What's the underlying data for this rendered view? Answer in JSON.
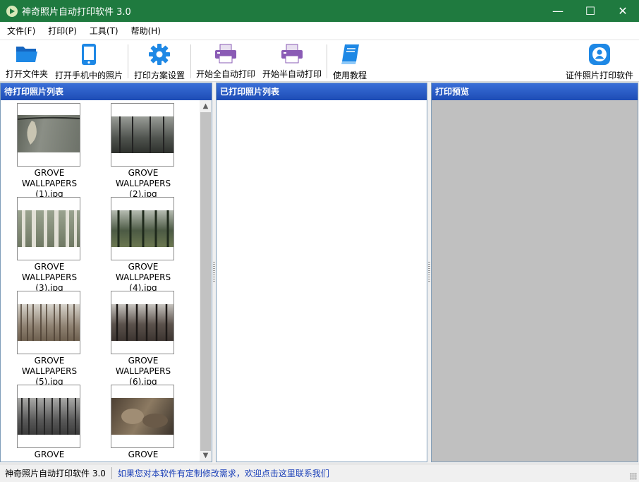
{
  "window": {
    "title": "神奇照片自动打印软件 3.0",
    "controls": {
      "minimize": "—",
      "maximize": "☐",
      "close": "✕"
    }
  },
  "menu": [
    {
      "label": "文件(F)"
    },
    {
      "label": "打印(P)"
    },
    {
      "label": "工具(T)"
    },
    {
      "label": "帮助(H)"
    }
  ],
  "toolbar": {
    "open_folder": "打开文件夹",
    "open_phone_photos": "打开手机中的照片",
    "print_settings": "打印方案设置",
    "auto_print": "开始全自动打印",
    "semi_auto_print": "开始半自动打印",
    "tutorial": "使用教程",
    "id_photo_software": "证件照片打印软件"
  },
  "panels": {
    "pending": {
      "title": "待打印照片列表",
      "items": [
        {
          "caption_line1": "GROVE WALLPAPERS",
          "caption_line2": "(1).jpg"
        },
        {
          "caption_line1": "GROVE WALLPAPERS",
          "caption_line2": "(2).jpg"
        },
        {
          "caption_line1": "GROVE WALLPAPERS",
          "caption_line2": "(3).jpg"
        },
        {
          "caption_line1": "GROVE WALLPAPERS",
          "caption_line2": "(4).jpg"
        },
        {
          "caption_line1": "GROVE WALLPAPERS",
          "caption_line2": "(5).jpg"
        },
        {
          "caption_line1": "GROVE WALLPAPERS",
          "caption_line2": "(6).jpg"
        },
        {
          "caption_line1": "GROVE WALLPAPERS",
          "caption_line2": ""
        },
        {
          "caption_line1": "GROVE WALLPAPERS",
          "caption_line2": ""
        }
      ]
    },
    "printed": {
      "title": "已打印照片列表"
    },
    "preview": {
      "title": "打印预览"
    }
  },
  "statusbar": {
    "app_name": "神奇照片自动打印软件 3.0",
    "custom_link": "如果您对本软件有定制修改需求，欢迎点击这里联系我们"
  },
  "colors": {
    "titlebar": "#1f7a3f",
    "panel_header": "#1d4cb5",
    "folder_icon": "#1e88e5",
    "gear_icon": "#1e88e5",
    "printer_icon": "#8a5bb5",
    "link": "#1a3fb8"
  },
  "icons": {
    "open_folder": "folder-icon",
    "open_phone_photos": "phone-icon",
    "print_settings": "gear-icon",
    "auto_print": "printer-icon",
    "semi_auto_print": "printer-icon",
    "tutorial": "book-icon",
    "id_photo_software": "user-icon"
  }
}
